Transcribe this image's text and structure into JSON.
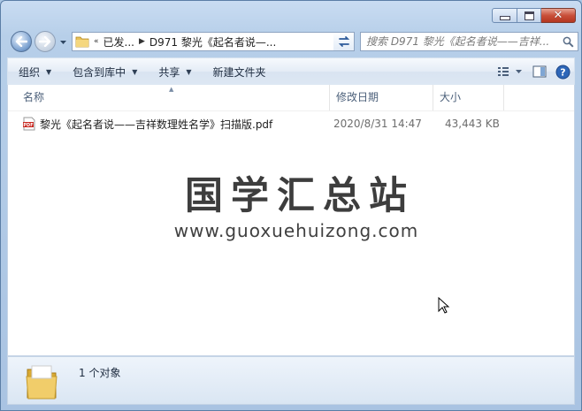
{
  "window": {
    "minimize_icon": "minimize-icon",
    "maximize_icon": "maximize-icon",
    "close_icon": "close-icon"
  },
  "address": {
    "overflow": "«",
    "crumbs": [
      "已发...",
      "D971 黎光《起名者说—..."
    ]
  },
  "search": {
    "placeholder": "搜索 D971 黎光《起名者说——吉祥..."
  },
  "toolbar": {
    "organize": "组织",
    "include_in_library": "包含到库中",
    "share": "共享",
    "new_folder": "新建文件夹"
  },
  "columns": {
    "name": "名称",
    "date": "修改日期",
    "size": "大小"
  },
  "files": [
    {
      "name": "黎光《起名者说——吉祥数理姓名学》扫描版.pdf",
      "date": "2020/8/31 14:47",
      "size": "43,443 KB",
      "icon": "pdf-icon"
    }
  ],
  "watermark": {
    "title": "国学汇总站",
    "url": "www.guoxuehuizong.com"
  },
  "details": {
    "count": "1 个对象"
  },
  "colors": {
    "window_frame": "#b7cfe9",
    "close_button": "#c9503a",
    "content_bg": "#ffffff"
  }
}
